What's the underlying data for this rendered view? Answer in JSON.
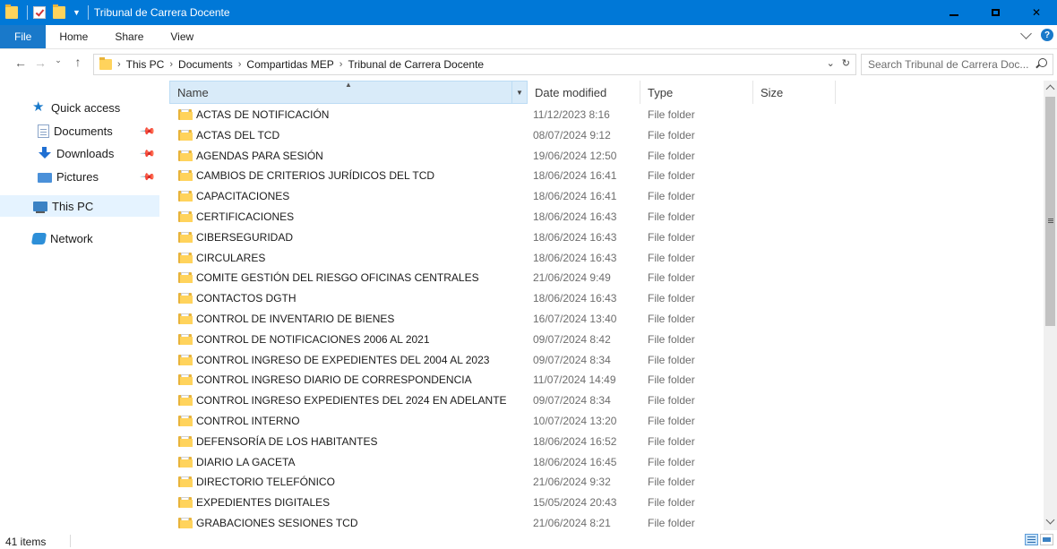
{
  "window": {
    "title": "Tribunal de Carrera Docente"
  },
  "ribbon": {
    "tabs": [
      "File",
      "Home",
      "Share",
      "View"
    ]
  },
  "address": {
    "crumbs": [
      "This PC",
      "Documents",
      "Compartidas MEP",
      "Tribunal de Carrera Docente"
    ]
  },
  "search": {
    "placeholder": "Search Tribunal de Carrera Doc..."
  },
  "nav": {
    "quick_access": "Quick access",
    "documents": "Documents",
    "downloads": "Downloads",
    "pictures": "Pictures",
    "this_pc": "This PC",
    "network": "Network"
  },
  "columns": {
    "name": "Name",
    "date": "Date modified",
    "type": "Type",
    "size": "Size"
  },
  "files": [
    {
      "name": "ACTAS DE NOTIFICACIÓN",
      "date": "11/12/2023 8:16",
      "type": "File folder"
    },
    {
      "name": "ACTAS DEL TCD",
      "date": "08/07/2024 9:12",
      "type": "File folder"
    },
    {
      "name": "AGENDAS PARA SESIÓN",
      "date": "19/06/2024 12:50",
      "type": "File folder"
    },
    {
      "name": "CAMBIOS DE CRITERIOS JURÍDICOS DEL TCD",
      "date": "18/06/2024 16:41",
      "type": "File folder"
    },
    {
      "name": "CAPACITACIONES",
      "date": "18/06/2024 16:41",
      "type": "File folder"
    },
    {
      "name": "CERTIFICACIONES",
      "date": "18/06/2024 16:43",
      "type": "File folder"
    },
    {
      "name": "CIBERSEGURIDAD",
      "date": "18/06/2024 16:43",
      "type": "File folder"
    },
    {
      "name": "CIRCULARES",
      "date": "18/06/2024 16:43",
      "type": "File folder"
    },
    {
      "name": "COMITE GESTIÓN DEL RIESGO OFICINAS CENTRALES",
      "date": "21/06/2024 9:49",
      "type": "File folder"
    },
    {
      "name": "CONTACTOS DGTH",
      "date": "18/06/2024 16:43",
      "type": "File folder"
    },
    {
      "name": "CONTROL DE INVENTARIO DE BIENES",
      "date": "16/07/2024 13:40",
      "type": "File folder"
    },
    {
      "name": "CONTROL DE NOTIFICACIONES 2006 AL 2021",
      "date": "09/07/2024 8:42",
      "type": "File folder"
    },
    {
      "name": "CONTROL INGRESO DE EXPEDIENTES DEL 2004 AL 2023",
      "date": "09/07/2024 8:34",
      "type": "File folder"
    },
    {
      "name": "CONTROL INGRESO DIARIO DE CORRESPONDENCIA",
      "date": "11/07/2024 14:49",
      "type": "File folder"
    },
    {
      "name": "CONTROL INGRESO EXPEDIENTES DEL 2024 EN ADELANTE",
      "date": "09/07/2024 8:34",
      "type": "File folder"
    },
    {
      "name": "CONTROL INTERNO",
      "date": "10/07/2024 13:20",
      "type": "File folder"
    },
    {
      "name": "DEFENSORÍA DE LOS HABITANTES",
      "date": "18/06/2024 16:52",
      "type": "File folder"
    },
    {
      "name": "DIARIO LA GACETA",
      "date": "18/06/2024 16:45",
      "type": "File folder"
    },
    {
      "name": "DIRECTORIO TELEFÓNICO",
      "date": "21/06/2024 9:32",
      "type": "File folder"
    },
    {
      "name": "EXPEDIENTES DIGITALES",
      "date": "15/05/2024 20:43",
      "type": "File folder"
    },
    {
      "name": "GRABACIONES SESIONES TCD",
      "date": "21/06/2024 8:21",
      "type": "File folder"
    }
  ],
  "status": {
    "count": "41 items"
  },
  "colors": {
    "titlebar": "#0078d7",
    "file_tab": "#1979ca",
    "selection": "#e5f3ff",
    "folder": "#ffd35c"
  },
  "icons": [
    "folder-icon",
    "search-icon",
    "refresh-icon",
    "star-icon",
    "pin-icon",
    "this-pc-icon",
    "network-icon"
  ]
}
